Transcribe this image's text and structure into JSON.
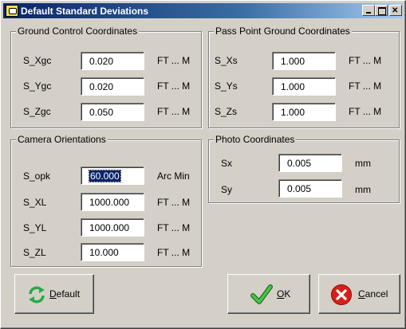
{
  "window": {
    "title": "Default Standard Deviations",
    "title_icon": "app-icon",
    "controls": [
      "minimize",
      "maximize",
      "close"
    ]
  },
  "ground_control": {
    "title": "Ground Control Coordinates",
    "rows": [
      {
        "label": "S_Xgc",
        "value": "0.020",
        "unit": "FT ... M"
      },
      {
        "label": "S_Ygc",
        "value": "0.020",
        "unit": "FT ... M"
      },
      {
        "label": "S_Zgc",
        "value": "0.050",
        "unit": "FT ... M"
      }
    ]
  },
  "pass_point": {
    "title": "Pass Point Ground Coordinates",
    "rows": [
      {
        "label": "S_Xs",
        "value": "1.000",
        "unit": "FT ... M"
      },
      {
        "label": "S_Ys",
        "value": "1.000",
        "unit": "FT ... M"
      },
      {
        "label": "S_Zs",
        "value": "1.000",
        "unit": "FT ... M"
      }
    ]
  },
  "camera": {
    "title": "Camera Orientations",
    "rows": [
      {
        "label": "S_opk",
        "value": "60.000",
        "unit": "Arc Min"
      },
      {
        "label": "S_XL",
        "value": "1000.000",
        "unit": "FT ... M"
      },
      {
        "label": "S_YL",
        "value": "1000.000",
        "unit": "FT ... M"
      },
      {
        "label": "S_ZL",
        "value": "10.000",
        "unit": "FT ... M"
      }
    ]
  },
  "photo": {
    "title": "Photo Coordinates",
    "rows": [
      {
        "label": "Sx",
        "value": "0.005",
        "unit": "mm"
      },
      {
        "label": "Sy",
        "value": "0.005",
        "unit": "mm"
      }
    ]
  },
  "buttons": {
    "default": {
      "label_underlined": "D",
      "label_rest": "efault",
      "icon": "refresh-icon"
    },
    "ok": {
      "label_underlined": "O",
      "label_rest": "K",
      "icon": "checkmark-icon"
    },
    "cancel": {
      "label_underlined": "C",
      "label_rest": "ancel",
      "icon": "cancel-x-icon"
    }
  },
  "colors": {
    "titlebar_start": "#0a246a",
    "titlebar_end": "#a6caf0",
    "face": "#d4d0c8",
    "ok_check": "#2e9a2e",
    "cancel_red": "#d8201a",
    "default_arrows": "#2aa84a"
  }
}
